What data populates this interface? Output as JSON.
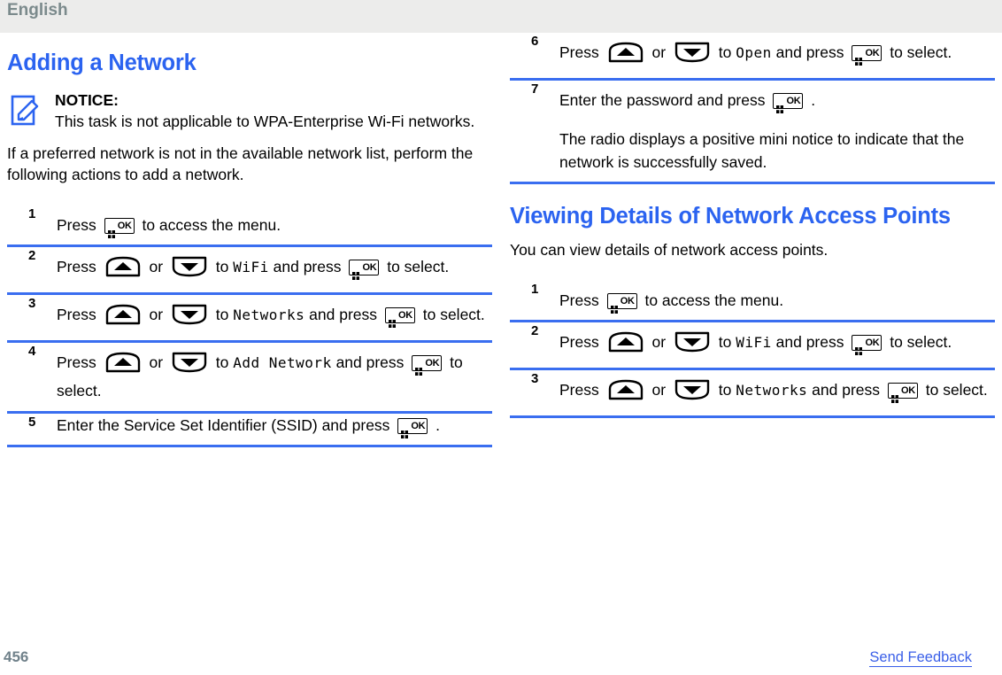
{
  "header": {
    "language": "English"
  },
  "icons": {
    "notice": "notice-pencil-icon",
    "ok_key": "ok-menu-key-icon",
    "up_key": "arrow-up-key-icon",
    "down_key": "arrow-down-key-icon",
    "ok_label": "OK"
  },
  "left_column": {
    "title": "Adding a Network",
    "notice": {
      "label": "NOTICE:",
      "text": "This task is not applicable to WPA-Enterprise Wi-Fi networks."
    },
    "intro": "If a preferred network is not in the available network list, perform the following actions to add a network.",
    "steps": [
      {
        "num": "1",
        "parts": [
          {
            "type": "text",
            "value": "Press "
          },
          {
            "type": "okkey"
          },
          {
            "type": "text",
            "value": " to access the menu."
          }
        ]
      },
      {
        "num": "2",
        "parts": [
          {
            "type": "text",
            "value": "Press "
          },
          {
            "type": "upkey"
          },
          {
            "type": "text",
            "value": " or "
          },
          {
            "type": "downkey"
          },
          {
            "type": "text",
            "value": " to "
          },
          {
            "type": "mono",
            "value": "WiFi"
          },
          {
            "type": "text",
            "value": " and press "
          },
          {
            "type": "okkey"
          },
          {
            "type": "text",
            "value": " to select."
          }
        ]
      },
      {
        "num": "3",
        "parts": [
          {
            "type": "text",
            "value": "Press "
          },
          {
            "type": "upkey"
          },
          {
            "type": "text",
            "value": " or "
          },
          {
            "type": "downkey"
          },
          {
            "type": "text",
            "value": " to "
          },
          {
            "type": "mono",
            "value": "Networks"
          },
          {
            "type": "text",
            "value": " and press "
          },
          {
            "type": "okkey"
          },
          {
            "type": "text",
            "value": " to select."
          }
        ]
      },
      {
        "num": "4",
        "parts": [
          {
            "type": "text",
            "value": "Press "
          },
          {
            "type": "upkey"
          },
          {
            "type": "text",
            "value": " or "
          },
          {
            "type": "downkey"
          },
          {
            "type": "text",
            "value": " to "
          },
          {
            "type": "mono",
            "value": "Add Network"
          },
          {
            "type": "text",
            "value": " and press "
          },
          {
            "type": "okkey"
          },
          {
            "type": "text",
            "value": " to select."
          }
        ]
      },
      {
        "num": "5",
        "inline": true,
        "parts": [
          {
            "type": "text",
            "value": "Enter the Service Set Identifier (SSID) and press "
          },
          {
            "type": "okkey"
          },
          {
            "type": "text",
            "value": " ."
          }
        ]
      }
    ]
  },
  "right_column": {
    "steps_top": [
      {
        "num": "6",
        "parts": [
          {
            "type": "text",
            "value": "Press "
          },
          {
            "type": "upkey"
          },
          {
            "type": "text",
            "value": " or "
          },
          {
            "type": "downkey"
          },
          {
            "type": "text",
            "value": " to "
          },
          {
            "type": "mono",
            "value": "Open"
          },
          {
            "type": "text",
            "value": " and press "
          },
          {
            "type": "okkey"
          },
          {
            "type": "text",
            "value": " to select."
          }
        ]
      },
      {
        "num": "7",
        "parts": [
          {
            "type": "text",
            "value": "Enter the password and press "
          },
          {
            "type": "okkey"
          },
          {
            "type": "text",
            "value": " ."
          }
        ],
        "sub": "The radio displays a positive mini notice to indicate that the network is successfully saved."
      }
    ],
    "title": "Viewing Details of Network Access Points",
    "intro": "You can view details of network access points.",
    "steps": [
      {
        "num": "1",
        "parts": [
          {
            "type": "text",
            "value": "Press "
          },
          {
            "type": "okkey"
          },
          {
            "type": "text",
            "value": " to access the menu."
          }
        ]
      },
      {
        "num": "2",
        "parts": [
          {
            "type": "text",
            "value": "Press "
          },
          {
            "type": "upkey"
          },
          {
            "type": "text",
            "value": " or "
          },
          {
            "type": "downkey"
          },
          {
            "type": "text",
            "value": " to "
          },
          {
            "type": "mono",
            "value": "WiFi"
          },
          {
            "type": "text",
            "value": " and press "
          },
          {
            "type": "okkey"
          },
          {
            "type": "text",
            "value": " to select."
          }
        ]
      },
      {
        "num": "3",
        "parts": [
          {
            "type": "text",
            "value": "Press "
          },
          {
            "type": "upkey"
          },
          {
            "type": "text",
            "value": " or "
          },
          {
            "type": "downkey"
          },
          {
            "type": "text",
            "value": " to "
          },
          {
            "type": "mono",
            "value": "Networks"
          },
          {
            "type": "text",
            "value": " and press "
          },
          {
            "type": "okkey"
          },
          {
            "type": "text",
            "value": " to select."
          }
        ]
      }
    ]
  },
  "footer": {
    "page_number": "456",
    "feedback_link": "Send Feedback"
  },
  "colors": {
    "heading_blue": "#2b63f0",
    "rule_blue": "#3a6ef0",
    "link_blue": "#3a5fe8",
    "header_band": "#ececeb",
    "header_text": "#7b8a8c",
    "page_number": "#70818a"
  }
}
